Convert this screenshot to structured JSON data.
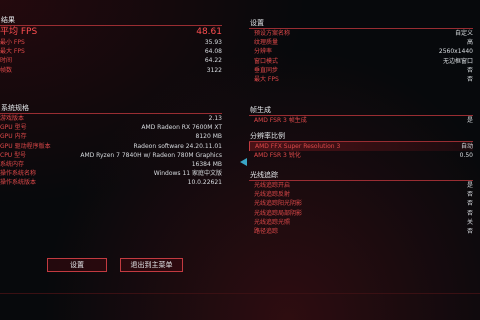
{
  "results": {
    "title": "结果",
    "avg_fps_label": "平均 FPS",
    "avg_fps_value": "48.61",
    "rows": [
      {
        "label": "最小 FPS",
        "value": "35.93"
      },
      {
        "label": "最大 FPS",
        "value": "64.08"
      },
      {
        "label": "时间",
        "value": "64.22"
      },
      {
        "label": "帧数",
        "value": "3122"
      }
    ]
  },
  "system": {
    "title": "系统规格",
    "rows": [
      {
        "label": "游戏版本",
        "value": "2.13"
      },
      {
        "label": "GPU 型号",
        "value": "AMD Radeon RX 7600M XT"
      },
      {
        "label": "GPU 内存",
        "value": "8120 MB"
      },
      {
        "label": "GPU 驱动程序版本",
        "value": "Radeon software 24.20.11.01"
      },
      {
        "label": "CPU 型号",
        "value": "AMD Ryzen 7 7840H  w/ Radeon 780M Graphics"
      },
      {
        "label": "系统内存",
        "value": "16384 MB"
      },
      {
        "label": "操作系统名称",
        "value": "Windows 11 家庭中文版"
      },
      {
        "label": "操作系统版本",
        "value": "10.0.22621"
      }
    ]
  },
  "buttons": {
    "settings": "设置",
    "exit": "退出到主菜单"
  },
  "settings": {
    "title": "设置",
    "rows": [
      {
        "label": "预设方案名称",
        "value": "自定义"
      },
      {
        "label": "纹理质量",
        "value": "高"
      },
      {
        "label": "分辨率",
        "value": "2560x1440"
      },
      {
        "label": "窗口模式",
        "value": "无边框窗口"
      },
      {
        "label": "垂直同步",
        "value": "否"
      },
      {
        "label": "最大 FPS",
        "value": "否"
      }
    ]
  },
  "frame_gen": {
    "title": "帧生成",
    "rows": [
      {
        "label": "AMD FSR 3 帧生成",
        "value": "是"
      }
    ]
  },
  "resolution_scaling": {
    "title": "分辨率比例",
    "rows": [
      {
        "label": "AMD FFX Super Resolution 3",
        "value": "自动"
      },
      {
        "label": "AMD FSR 3 锐化",
        "value": "0.50"
      }
    ]
  },
  "ray_tracing": {
    "title": "光线追踪",
    "rows": [
      {
        "label": "光线追踪开启",
        "value": "是"
      },
      {
        "label": "光线追踪反射",
        "value": "否"
      },
      {
        "label": "光线追踪阳光阴影",
        "value": "否"
      },
      {
        "label": "光线追踪局部阴影",
        "value": "否"
      },
      {
        "label": "光线追踪光照",
        "value": "关"
      },
      {
        "label": "路径追踪",
        "value": "否"
      }
    ]
  },
  "colors": {
    "accent": "#e0494a",
    "line": "#b2343a",
    "cursor": "#3aa6c6"
  }
}
